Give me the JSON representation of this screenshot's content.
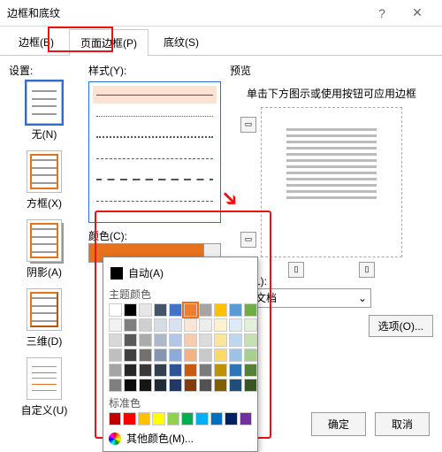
{
  "window": {
    "title": "边框和底纹"
  },
  "tabs": {
    "borders": "边框(B)",
    "pageBorders": "页面边框(P)",
    "shading": "底纹(S)"
  },
  "settings": {
    "label": "设置:",
    "none": "无(N)",
    "box": "方框(X)",
    "shadow": "阴影(A)",
    "threeD": "三维(D)",
    "custom": "自定义(U)"
  },
  "style": {
    "label": "样式(Y):"
  },
  "color": {
    "label": "颜色(C):",
    "selected": "#e8711c"
  },
  "popup": {
    "auto": "自动(A)",
    "themeHeader": "主题颜色",
    "theme": [
      [
        "#ffffff",
        "#000000",
        "#e7e6e6",
        "#44546a",
        "#4472c4",
        "#ed7d31",
        "#a5a5a5",
        "#ffc000",
        "#5b9bd5",
        "#70ad47"
      ],
      [
        "#f2f2f2",
        "#7f7f7f",
        "#d0cece",
        "#d6dce4",
        "#d9e2f3",
        "#fbe5d5",
        "#ededed",
        "#fff2cc",
        "#deebf6",
        "#e2efd9"
      ],
      [
        "#d8d8d8",
        "#595959",
        "#aeabab",
        "#adb9ca",
        "#b4c6e7",
        "#f7cbac",
        "#dbdbdb",
        "#fee599",
        "#bdd7ee",
        "#c5e0b3"
      ],
      [
        "#bfbfbf",
        "#3f3f3f",
        "#757070",
        "#8496b0",
        "#8eaadb",
        "#f4b183",
        "#c9c9c9",
        "#ffd965",
        "#9cc3e5",
        "#a8d08d"
      ],
      [
        "#a5a5a5",
        "#262626",
        "#3a3838",
        "#323f4f",
        "#2f5496",
        "#c55a11",
        "#7b7b7b",
        "#bf9000",
        "#2e75b5",
        "#538135"
      ],
      [
        "#7f7f7f",
        "#0c0c0c",
        "#171616",
        "#222a35",
        "#1f3864",
        "#833c0b",
        "#525252",
        "#7f6000",
        "#1e4e79",
        "#375623"
      ]
    ],
    "stdHeader": "标准色",
    "standard": [
      "#c00000",
      "#ff0000",
      "#ffc000",
      "#ffff00",
      "#92d050",
      "#00b050",
      "#00b0f0",
      "#0070c0",
      "#002060",
      "#7030a0"
    ],
    "more": "其他颜色(M)..."
  },
  "preview": {
    "label": "预览",
    "hint": "单击下方图示或使用按钮可应用边框"
  },
  "apply": {
    "label": "用于(L):",
    "value": "整篇文档"
  },
  "options": "选项(O)...",
  "buttons": {
    "ok": "确定",
    "cancel": "取消"
  }
}
